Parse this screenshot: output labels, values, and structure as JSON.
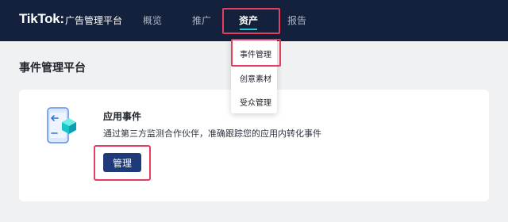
{
  "brand": {
    "logo": "TikTok:",
    "subtitle": "广告管理平台"
  },
  "nav": {
    "items": [
      {
        "label": "概览"
      },
      {
        "label": "推广"
      },
      {
        "label": "资产"
      },
      {
        "label": "报告"
      }
    ],
    "active": "资产"
  },
  "dropdown": {
    "items": [
      {
        "label": "事件管理"
      },
      {
        "label": "创意素材"
      },
      {
        "label": "受众管理"
      }
    ]
  },
  "page": {
    "title": "事件管理平台"
  },
  "card": {
    "title": "应用事件",
    "description": "通过第三方监测合作伙伴，准确跟踪您的应用内转化事件",
    "button_label": "管理"
  },
  "colors": {
    "nav_bg": "#13213d",
    "accent_underline": "#2ec5d3",
    "primary_button": "#1e3a78",
    "highlight": "#e43d5e"
  }
}
